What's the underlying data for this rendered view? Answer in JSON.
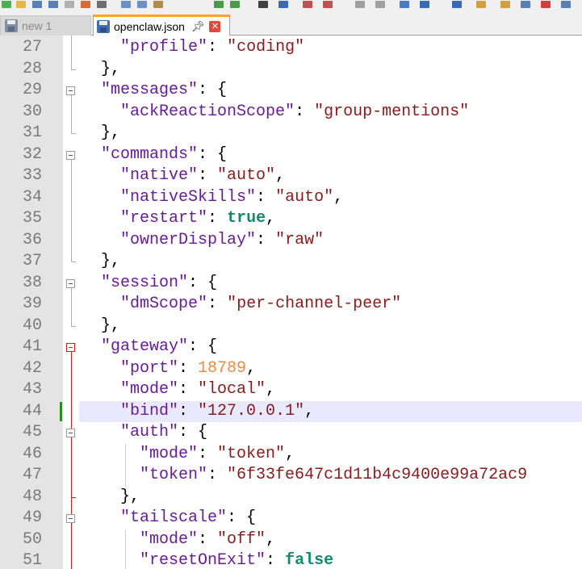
{
  "tabs": [
    {
      "label": "new 1",
      "active": false
    },
    {
      "label": "openclaw.json",
      "active": true
    }
  ],
  "editor": {
    "current_line": 44,
    "lines": [
      {
        "num": "27",
        "tokens": [
          [
            "p",
            "    "
          ],
          [
            "key",
            "\"profile\""
          ],
          [
            "p",
            ": "
          ],
          [
            "s",
            "\"coding\""
          ]
        ]
      },
      {
        "num": "28",
        "tokens": [
          [
            "p",
            "  },"
          ]
        ]
      },
      {
        "num": "29",
        "tokens": [
          [
            "p",
            "  "
          ],
          [
            "key",
            "\"messages\""
          ],
          [
            "p",
            ": {"
          ]
        ]
      },
      {
        "num": "30",
        "tokens": [
          [
            "p",
            "    "
          ],
          [
            "key",
            "\"ackReactionScope\""
          ],
          [
            "p",
            ": "
          ],
          [
            "s",
            "\"group-mentions\""
          ]
        ]
      },
      {
        "num": "31",
        "tokens": [
          [
            "p",
            "  },"
          ]
        ]
      },
      {
        "num": "32",
        "tokens": [
          [
            "p",
            "  "
          ],
          [
            "key",
            "\"commands\""
          ],
          [
            "p",
            ": {"
          ]
        ]
      },
      {
        "num": "33",
        "tokens": [
          [
            "p",
            "    "
          ],
          [
            "key",
            "\"native\""
          ],
          [
            "p",
            ": "
          ],
          [
            "s",
            "\"auto\""
          ],
          [
            "p",
            ","
          ]
        ]
      },
      {
        "num": "34",
        "tokens": [
          [
            "p",
            "    "
          ],
          [
            "key",
            "\"nativeSkills\""
          ],
          [
            "p",
            ": "
          ],
          [
            "s",
            "\"auto\""
          ],
          [
            "p",
            ","
          ]
        ]
      },
      {
        "num": "35",
        "tokens": [
          [
            "p",
            "    "
          ],
          [
            "key",
            "\"restart\""
          ],
          [
            "p",
            ": "
          ],
          [
            "b",
            "true"
          ],
          [
            "p",
            ","
          ]
        ]
      },
      {
        "num": "36",
        "tokens": [
          [
            "p",
            "    "
          ],
          [
            "key",
            "\"ownerDisplay\""
          ],
          [
            "p",
            ": "
          ],
          [
            "s",
            "\"raw\""
          ]
        ]
      },
      {
        "num": "37",
        "tokens": [
          [
            "p",
            "  },"
          ]
        ]
      },
      {
        "num": "38",
        "tokens": [
          [
            "p",
            "  "
          ],
          [
            "key",
            "\"session\""
          ],
          [
            "p",
            ": {"
          ]
        ]
      },
      {
        "num": "39",
        "tokens": [
          [
            "p",
            "    "
          ],
          [
            "key",
            "\"dmScope\""
          ],
          [
            "p",
            ": "
          ],
          [
            "s",
            "\"per-channel-peer\""
          ]
        ]
      },
      {
        "num": "40",
        "tokens": [
          [
            "p",
            "  },"
          ]
        ]
      },
      {
        "num": "41",
        "tokens": [
          [
            "p",
            "  "
          ],
          [
            "key",
            "\"gateway\""
          ],
          [
            "p",
            ": {"
          ]
        ]
      },
      {
        "num": "42",
        "tokens": [
          [
            "p",
            "    "
          ],
          [
            "key",
            "\"port\""
          ],
          [
            "p",
            ": "
          ],
          [
            "n",
            "18789"
          ],
          [
            "p",
            ","
          ]
        ]
      },
      {
        "num": "43",
        "tokens": [
          [
            "p",
            "    "
          ],
          [
            "key",
            "\"mode\""
          ],
          [
            "p",
            ": "
          ],
          [
            "s",
            "\"local\""
          ],
          [
            "p",
            ","
          ]
        ]
      },
      {
        "num": "44",
        "tokens": [
          [
            "p",
            "    "
          ],
          [
            "key",
            "\"bind\""
          ],
          [
            "p",
            ": "
          ],
          [
            "s",
            "\"127.0.0.1\""
          ],
          [
            "p",
            ","
          ]
        ]
      },
      {
        "num": "45",
        "tokens": [
          [
            "p",
            "    "
          ],
          [
            "key",
            "\"auth\""
          ],
          [
            "p",
            ": {"
          ]
        ]
      },
      {
        "num": "46",
        "tokens": [
          [
            "p",
            "      "
          ],
          [
            "key",
            "\"mode\""
          ],
          [
            "p",
            ": "
          ],
          [
            "s",
            "\"token\""
          ],
          [
            "p",
            ","
          ]
        ]
      },
      {
        "num": "47",
        "tokens": [
          [
            "p",
            "      "
          ],
          [
            "key",
            "\"token\""
          ],
          [
            "p",
            ": "
          ],
          [
            "s",
            "\"6f33fe647c1d11b4c9400e99a72ac9"
          ]
        ]
      },
      {
        "num": "48",
        "tokens": [
          [
            "p",
            "    },"
          ]
        ]
      },
      {
        "num": "49",
        "tokens": [
          [
            "p",
            "    "
          ],
          [
            "key",
            "\"tailscale\""
          ],
          [
            "p",
            ": {"
          ]
        ]
      },
      {
        "num": "50",
        "tokens": [
          [
            "p",
            "      "
          ],
          [
            "key",
            "\"mode\""
          ],
          [
            "p",
            ": "
          ],
          [
            "s",
            "\"off\""
          ],
          [
            "p",
            ","
          ]
        ]
      },
      {
        "num": "51",
        "tokens": [
          [
            "p",
            "      "
          ],
          [
            "key",
            "\"resetOnExit\""
          ],
          [
            "p",
            ": "
          ],
          [
            "b",
            "false"
          ]
        ]
      }
    ]
  },
  "colors": {
    "key": "#6a1b9a",
    "string": "#8b1a1a",
    "number": "#f08a3c",
    "boolean": "#128a6e",
    "current_line_bg": "#e8e8ff",
    "gutter_bg": "#e4e4e4",
    "fold_active": "#d02020"
  }
}
